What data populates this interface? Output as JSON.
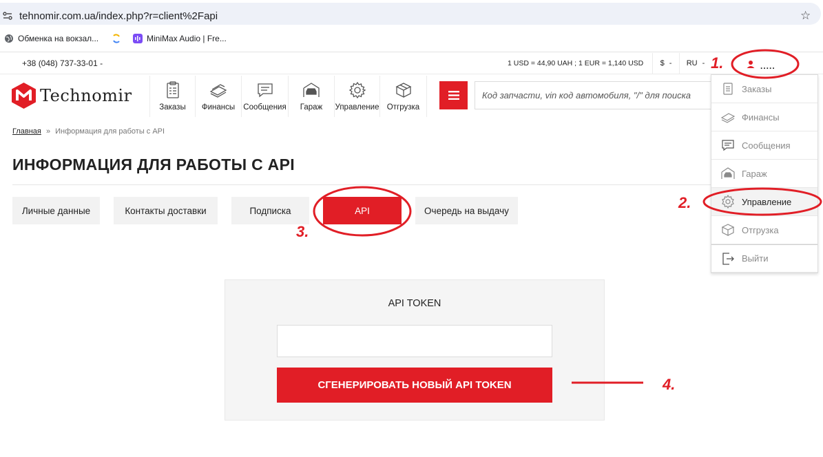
{
  "browser": {
    "url": "tehnomir.com.ua/index.php?r=client%2Fapi",
    "bookmarks": [
      {
        "label": "Обменка на вокзал...",
        "icon": "globe-icon"
      },
      {
        "label": "",
        "icon": "sync-icon"
      },
      {
        "label": "MiniMax Audio | Fre...",
        "icon": "minimax-icon"
      }
    ]
  },
  "topbar": {
    "phone": "+38 (048) 737-33-01 -",
    "rates": "1 USD = 44,90 UAH ; 1 EUR = 1,140 USD",
    "currency": "$",
    "currency_arrow": "-",
    "language": "RU",
    "language_arrow": "-",
    "user_name": "....."
  },
  "logo": {
    "text": "Technomir"
  },
  "nav": {
    "items": [
      {
        "label": "Заказы",
        "icon": "clipboard-icon"
      },
      {
        "label": "Финансы",
        "icon": "money-icon"
      },
      {
        "label": "Сообщения",
        "icon": "message-icon"
      },
      {
        "label": "Гараж",
        "icon": "garage-icon"
      },
      {
        "label": "Управление",
        "icon": "gear-icon"
      },
      {
        "label": "Отгрузка",
        "icon": "box-icon"
      }
    ]
  },
  "search": {
    "placeholder": "Код запчасти, vin код автомобиля, \"/\" для поиска"
  },
  "breadcrumb": {
    "home": "Главная",
    "separator": "»",
    "current": "Информация для работы с API"
  },
  "page_title": "ИНФОРМАЦИЯ ДЛЯ РАБОТЫ С API",
  "tabs": [
    {
      "label": "Личные данные",
      "active": false
    },
    {
      "label": "Контакты доставки",
      "active": false
    },
    {
      "label": "Подписка",
      "active": false
    },
    {
      "label": "API",
      "active": true
    },
    {
      "label": "Очередь на выдачу",
      "active": false
    }
  ],
  "token": {
    "label": "API TOKEN",
    "value": "",
    "button": "СГЕНЕРИРОВАТЬ НОВЫЙ API TOKEN"
  },
  "dropdown": {
    "items": [
      {
        "label": "Заказы",
        "icon": "clipboard-icon"
      },
      {
        "label": "Финансы",
        "icon": "money-icon"
      },
      {
        "label": "Сообщения",
        "icon": "message-icon"
      },
      {
        "label": "Гараж",
        "icon": "garage-icon"
      },
      {
        "label": "Управление",
        "icon": "gear-icon",
        "active": true
      },
      {
        "label": "Отгрузка",
        "icon": "box-icon"
      },
      {
        "label": "Выйти",
        "icon": "logout-icon"
      }
    ]
  },
  "annotations": {
    "step1": "1.",
    "step2": "2.",
    "step3": "3.",
    "step4": "4."
  },
  "colors": {
    "brand": "#e11e26",
    "annotation": "#e11e26"
  }
}
